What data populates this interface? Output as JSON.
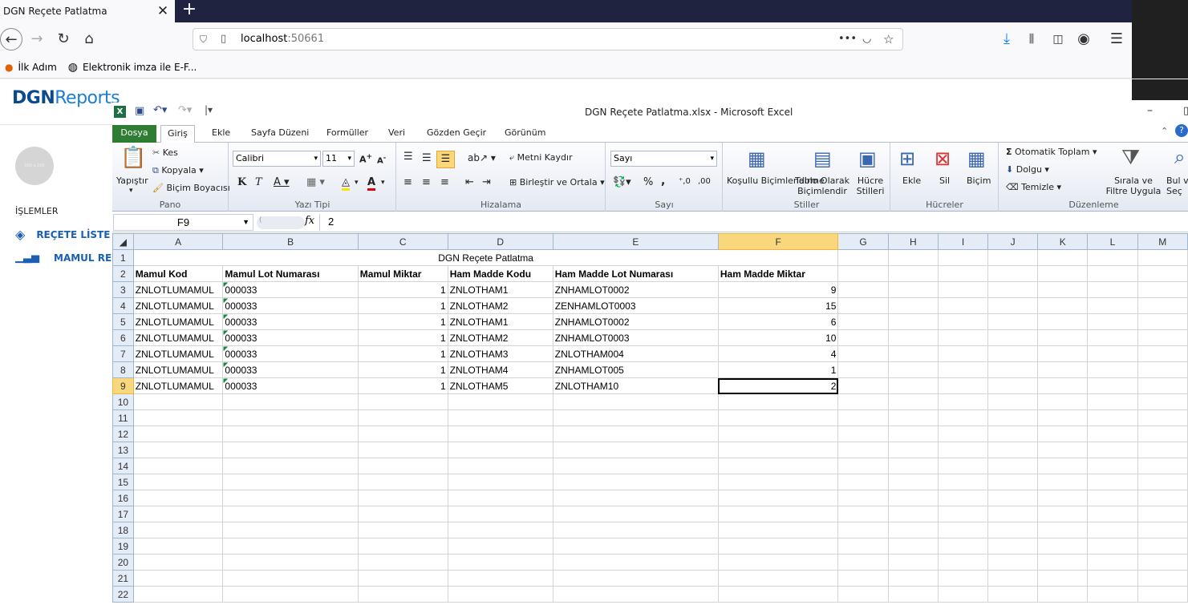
{
  "browser": {
    "tab_title": "DGN Reçete Patlatma",
    "tab_close": "✕",
    "new_tab": "+",
    "url_host": "localhost",
    "url_port": ":50661",
    "url_dots": "•••",
    "bookmarks": [
      "İlk Adım",
      "Elektronik imza ile E-F..."
    ]
  },
  "app": {
    "logo_dgn": "DGN",
    "logo_reports": "Reports",
    "avatar_text": "100 x 100",
    "section": "İŞLEMLER",
    "menu": [
      "REÇETE LİSTE",
      "MAMUL REÇET"
    ],
    "brand_color": "#1a5fb4",
    "logo_color": "#0b4a8b"
  },
  "excel": {
    "window_title": "DGN Reçete Patlatma.xlsx  -  Microsoft Excel",
    "tabs": [
      "Dosya",
      "Giriş",
      "Ekle",
      "Sayfa Düzeni",
      "Formüller",
      "Veri",
      "Gözden Geçir",
      "Görünüm"
    ],
    "active_tab": "Giriş",
    "ribbon": {
      "pano": {
        "label": "Pano",
        "paste": "Yapıştır",
        "cut": "Kes",
        "copy": "Kopyala",
        "format_painter": "Biçim Boyacısı"
      },
      "font": {
        "label": "Yazı Tipi",
        "name": "Calibri",
        "size": "11"
      },
      "align": {
        "label": "Hizalama",
        "wrap": "Metni Kaydır",
        "merge": "Birleştir ve Ortala"
      },
      "number": {
        "label": "Sayı",
        "format": "Sayı"
      },
      "styles": {
        "label": "Stiller",
        "conditional": "Koşullu Biçimlendirme",
        "table": "Tablo Olarak Biçimlendir",
        "cell": "Hücre Stilleri"
      },
      "cells": {
        "label": "Hücreler",
        "insert": "Ekle",
        "delete": "Sil",
        "format": "Biçim"
      },
      "editing": {
        "label": "Düzenleme",
        "autosum": "Otomatik Toplam",
        "fill": "Dolgu",
        "clear": "Temizle",
        "sort": "Sırala ve Filtre Uygula",
        "find": "Bul ve Seç"
      }
    },
    "name_box": "F9",
    "formula": "2",
    "columns": [
      "A",
      "B",
      "C",
      "D",
      "E",
      "F",
      "G",
      "H",
      "I",
      "J",
      "K",
      "L",
      "M"
    ],
    "selected_column": "F",
    "selected_row": 9,
    "sheet_title": "DGN Reçete Patlatma",
    "headers": [
      "Mamul Kod",
      "Mamul Lot Numarası",
      "Mamul Miktar",
      "Ham Madde Kodu",
      "Ham Madde Lot Numarası",
      "Ham Madde Miktar"
    ],
    "rows": [
      [
        "ZNLOTLUMAMUL",
        "000033",
        "1",
        "ZNLOTHAM1",
        "ZNHAMLOT0002",
        "9"
      ],
      [
        "ZNLOTLUMAMUL",
        "000033",
        "1",
        "ZNLOTHAM2",
        "ZENHAMLOT0003",
        "15"
      ],
      [
        "ZNLOTLUMAMUL",
        "000033",
        "1",
        "ZNLOTHAM1",
        "ZNHAMLOT0002",
        "6"
      ],
      [
        "ZNLOTLUMAMUL",
        "000033",
        "1",
        "ZNLOTHAM2",
        "ZNHAMLOT0003",
        "10"
      ],
      [
        "ZNLOTLUMAMUL",
        "000033",
        "1",
        "ZNLOTHAM3",
        "ZNLOTHAM004",
        "4"
      ],
      [
        "ZNLOTLUMAMUL",
        "000033",
        "1",
        "ZNLOTHAM4",
        "ZNHAMLOT005",
        "1"
      ],
      [
        "ZNLOTLUMAMUL",
        "000033",
        "1",
        "ZNLOTHAM5",
        "ZNLOTHAM10",
        "2"
      ]
    ],
    "total_rows": 22
  }
}
